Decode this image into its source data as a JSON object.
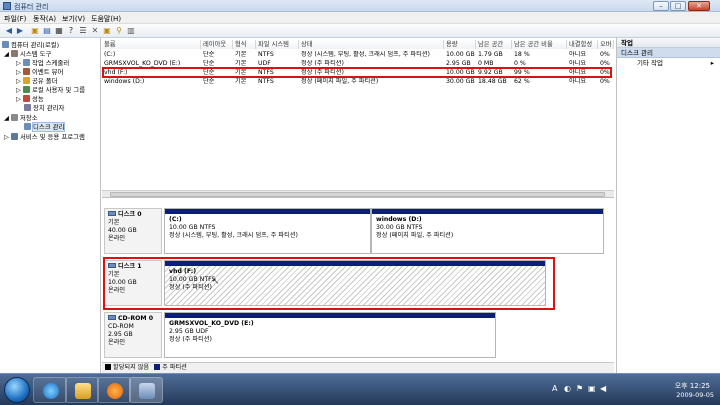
{
  "window": {
    "title": "컴퓨터 관리"
  },
  "menu": [
    "파일(F)",
    "동작(A)",
    "보기(V)",
    "도움말(H)"
  ],
  "tree": {
    "root": "컴퓨터 관리(로컬)",
    "system_tools": "시스템 도구",
    "task_scheduler": "작업 스케줄러",
    "event_viewer": "이벤트 뷰어",
    "shared_folders": "공유 폴더",
    "local_users": "로컬 사용자 및 그룹",
    "performance": "성능",
    "device_manager": "장치 관리자",
    "storage": "저장소",
    "disk_management": "디스크 관리",
    "services": "서비스 및 응용 프로그램"
  },
  "volume_table": {
    "columns": [
      "볼륨",
      "레이아웃",
      "형식",
      "파일 시스템",
      "상태",
      "용량",
      "남은 공간",
      "남은 공간 비율",
      "내결함성",
      "오버"
    ],
    "rows": [
      [
        "(C:)",
        "단순",
        "기본",
        "NTFS",
        "정상 (시스템, 부팅, 활성, 크래시 덤프, 주 파티션)",
        "10.00 GB",
        "1.79 GB",
        "18 %",
        "아니요",
        "0%"
      ],
      [
        "GRMSXVOL_KO_DVD (E:)",
        "단순",
        "기본",
        "UDF",
        "정상 (주 파티션)",
        "2.95 GB",
        "0 MB",
        "0 %",
        "아니요",
        "0%"
      ],
      [
        "vhd (F:)",
        "단순",
        "기본",
        "NTFS",
        "정상 (주 파티션)",
        "10.00 GB",
        "9.92 GB",
        "99 %",
        "아니요",
        "0%"
      ],
      [
        "windows (D:)",
        "단순",
        "기본",
        "NTFS",
        "정상 (페이지 파일, 주 파티션)",
        "30.00 GB",
        "18.48 GB",
        "62 %",
        "아니요",
        "0%"
      ]
    ],
    "highlighted_row": 2
  },
  "disks": [
    {
      "name": "디스크 0",
      "type": "기본",
      "size": "40.00 GB",
      "status": "온라인",
      "partitions": [
        {
          "name": "(C:)",
          "size": "10.00 GB NTFS",
          "status": "정상 (시스템, 부팅, 활성, 크래시 덤프, 주 파티션)"
        },
        {
          "name": "windows (D:)",
          "size": "30.00 GB NTFS",
          "status": "정상 (페이지 파일, 주 파티션)"
        }
      ]
    },
    {
      "name": "디스크 1",
      "type": "기본",
      "size": "10.00 GB",
      "status": "온라인",
      "partitions": [
        {
          "name": "vhd (F:)",
          "size": "10.00 GB NTFS",
          "status": "정상 (주 파티션)"
        }
      ]
    },
    {
      "name": "CD-ROM 0",
      "type": "CD-ROM",
      "size": "2.95 GB",
      "status": "온라인",
      "partitions": [
        {
          "name": "GRMSXVOL_KO_DVD (E:)",
          "size": "2.95 GB UDF",
          "status": "정상 (주 파티션)"
        }
      ]
    }
  ],
  "legend": {
    "unallocated": "할당되지 않음",
    "primary": "주 파티션",
    "unallocated_color": "#000000",
    "primary_color": "#0d1e7a"
  },
  "actions": {
    "header": "작업",
    "section": "디스크 관리",
    "more": "기타 작업"
  },
  "taskbar": {
    "time": "오후 12:25",
    "date": "2009-09-05",
    "ime": "A"
  },
  "colors": {
    "highlight_red": "#dd1111",
    "partition_bar": "#0d1e7a"
  }
}
